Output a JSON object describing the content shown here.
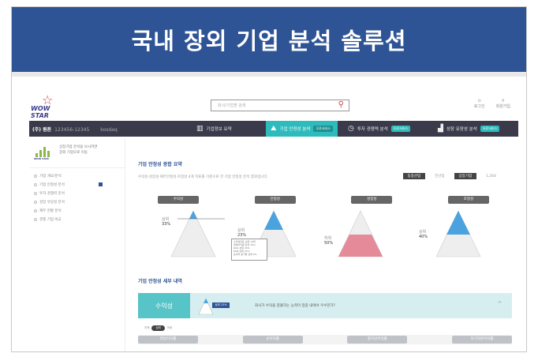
{
  "banner": {
    "title": "국내 장외 기업 분석 솔루션"
  },
  "logo": {
    "text": "WOW STAR"
  },
  "search": {
    "placeholder": "회사/기업명 검색"
  },
  "top_icons": [
    {
      "label": "로그인"
    },
    {
      "label": "회원가입"
    }
  ],
  "nav": {
    "company": "(주) 원튼",
    "company_sub": "123456-12345",
    "company_extra": "kosdaq",
    "items": [
      {
        "label": "기업정보 요약",
        "tag": ""
      },
      {
        "label": "기업 안정성 분석",
        "tag": "무료서비스"
      },
      {
        "label": "투자 경쟁력 분석",
        "tag": "유료서비스"
      },
      {
        "label": "성장 유망성 분석",
        "tag": "유료서비스"
      }
    ]
  },
  "sidebar": {
    "header_line1": "상장기업 분석을 보시려면",
    "header_line2": "장외 기업으로 이동",
    "logo_text": "WOW STAR",
    "items": [
      {
        "label": "기업 개요/분석",
        "checked": false
      },
      {
        "label": "기업 안정성 분석",
        "checked": true
      },
      {
        "label": "투자 경쟁력 분석",
        "checked": false
      },
      {
        "label": "성장 유망성 분석",
        "checked": false
      },
      {
        "label": "재무 현황 분석",
        "checked": false
      },
      {
        "label": "경쟁 기업 비교",
        "checked": false
      }
    ]
  },
  "main": {
    "summary_title": "기업 안정성 종합 요약",
    "summary_desc": "수익성·성장성·재무안정성·조정성 4개 지표를 기준으로 한 기업 안정성 분석 결과입니다.",
    "pills": [
      {
        "label": "동종산업",
        "dark": true
      },
      {
        "label": "전산업",
        "dark": false
      },
      {
        "label": "상장기업",
        "dark": true
      },
      {
        "label": "1,264",
        "dark": false
      }
    ],
    "categories": [
      "수익성",
      "안정성",
      "성장성",
      "조정성"
    ],
    "triangles": [
      {
        "label": "상위",
        "value": "33%",
        "color": "#4aa3df"
      },
      {
        "label": "상위",
        "value": "23%",
        "color": "#4aa3df"
      },
      {
        "label": "하위",
        "value": "50%",
        "color": "#e58a99"
      },
      {
        "label": "상위",
        "value": "40%",
        "color": "#4aa3df"
      }
    ],
    "tooltip": [
      "수익성지표 순위 12위",
      "영업이익률 상위 15%",
      "ROA 상위 20%",
      "ROE 상위 23%",
      "순이익 증가율 상위 5%"
    ],
    "detail_title": "기업 안정성 세부 내역",
    "panel_title": "수익성",
    "panel_badge": "상위 23%",
    "panel_question": "회사가 수익을 창출하는 능력이 업종 내에서 우수한가?",
    "panel_chevron": "^",
    "toggles": [
      "전체",
      "상위",
      "하위"
    ],
    "subtabs": [
      "영업이익률",
      "순이익률",
      "총자산이익률",
      "자기자본이익률"
    ]
  }
}
